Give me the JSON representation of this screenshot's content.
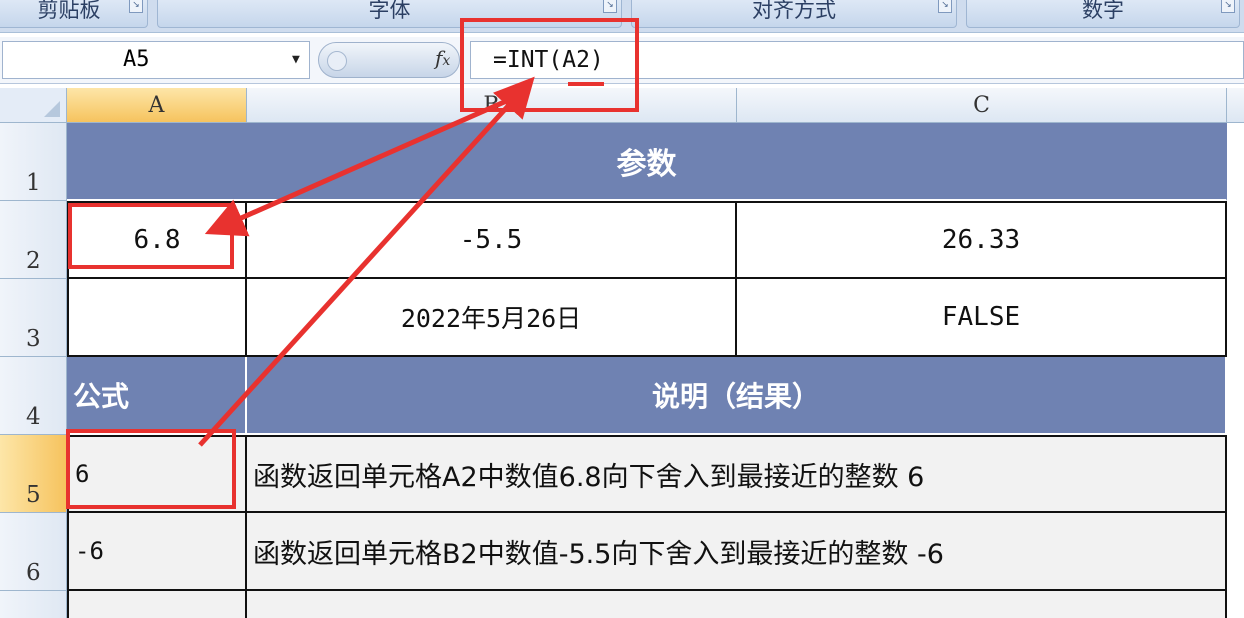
{
  "ribbon": {
    "groups": [
      "剪贴板",
      "字体",
      "对齐方式",
      "数字"
    ]
  },
  "formula_bar": {
    "name_box": "A5",
    "fx_icon": "fx-icon",
    "formula": "=INT(A2)"
  },
  "columns": [
    "A",
    "B",
    "C"
  ],
  "rows": [
    "1",
    "2",
    "3",
    "4",
    "5",
    "6"
  ],
  "sheet": {
    "r1_header": "参数",
    "a2": "6.8",
    "b2": "-5.5",
    "c2": "26.33",
    "b3": "2022年5月26日",
    "c3": "FALSE",
    "a4": "公式",
    "b4": "说明（结果）",
    "a5": "6",
    "b5": "函数返回单元格A2中数值6.8向下舍入到最接近的整数 6",
    "a6": "-6",
    "b6": "函数返回单元格B2中数值-5.5向下舍入到最接近的整数 -6"
  },
  "colors": {
    "header_fill": "#6f82b2",
    "annotation": "#e8322f",
    "selected_header": "#f6c35e"
  }
}
